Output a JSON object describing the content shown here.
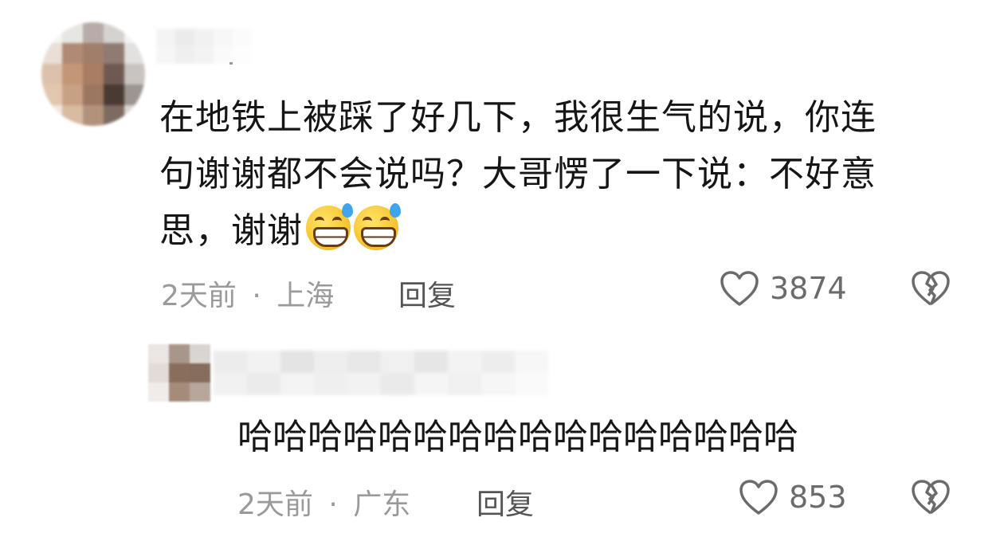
{
  "comment": {
    "text_line1": "在地铁上被踩了好几下，我很生气的说，你连",
    "text_line2": "句谢谢都不会说吗？大哥愣了一下说：不好意",
    "text_line3": "思，谢谢",
    "emoji_count": 2,
    "time": "2天前",
    "separator": "·",
    "location": "上海",
    "reply_label": "回复",
    "like_count": "3874"
  },
  "reply": {
    "text": "哈哈哈哈哈哈哈哈哈哈哈哈哈哈哈哈",
    "time": "2天前",
    "separator": "·",
    "location": "广东",
    "reply_label": "回复",
    "like_count": "853"
  },
  "icons": {
    "like": "heart-outline-icon",
    "dislike": "broken-heart-icon",
    "emoji": "grinning-sweat-emoji-icon"
  },
  "colors": {
    "text": "#161616",
    "meta": "#9a9a9a",
    "reply_link": "#555555",
    "icon": "#6b6b6b"
  }
}
